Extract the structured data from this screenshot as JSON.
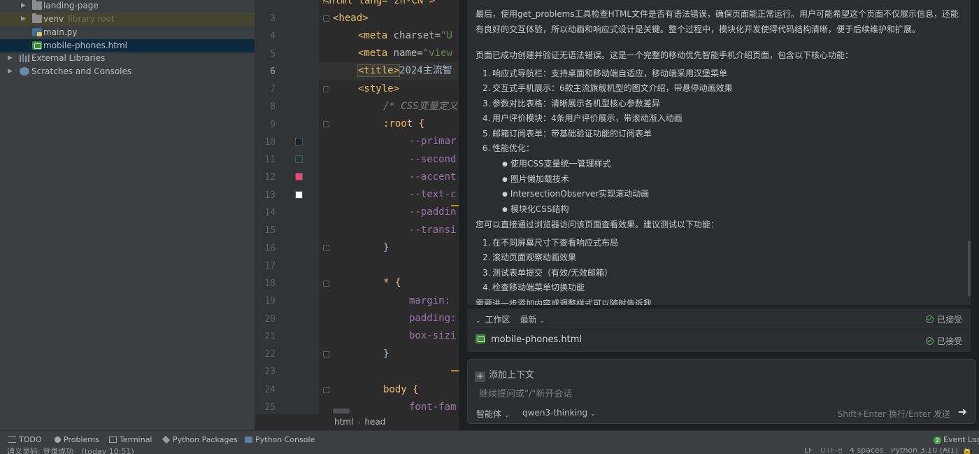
{
  "project_tree": {
    "items": [
      {
        "label": "landing-page",
        "note": ""
      },
      {
        "label": "venv",
        "note": "library root"
      },
      {
        "label": "main.py",
        "note": ""
      },
      {
        "label": "mobile-phones.html",
        "note": ""
      },
      {
        "label": "External Libraries",
        "note": ""
      },
      {
        "label": "Scratches and Consoles",
        "note": ""
      }
    ]
  },
  "editor": {
    "line_numbers": [
      "3",
      "4",
      "5",
      "6",
      "7",
      "8",
      "9",
      "10",
      "11",
      "12",
      "13",
      "14",
      "15",
      "16",
      "17",
      "18",
      "19",
      "20",
      "21",
      "22",
      "23",
      "24",
      "25"
    ],
    "current_line": "6",
    "swatch_colors": [
      "#0f2630",
      "#1c3a40",
      "#ef476f",
      "#ffffff"
    ],
    "top_fragment": "<html lang=\"zh-CN\">",
    "lines": {
      "l3": "<head>",
      "l4_tag": "<meta",
      "l4_attr": " charset=",
      "l4_str": "\"U",
      "l5_tag": "<meta",
      "l5_attr": " name=",
      "l5_str": "\"view",
      "l6_open": "<title>",
      "l6_text": "2024主流智",
      "l7": "<style>",
      "l8": "/* CSS变量定义",
      "l9": ":root {",
      "l10": "--primar",
      "l11": "--second",
      "l12": "--accent",
      "l13": "--text-c",
      "l14": "--paddin",
      "l15": "--transi",
      "l16": "}",
      "l18": "* {",
      "l19": "margin:",
      "l20": "padding:",
      "l21": "box-sizi",
      "l22": "}",
      "l24": "body {",
      "l25": "font-fam"
    },
    "breadcrumb": [
      "html",
      "head"
    ]
  },
  "chat": {
    "message": {
      "intro": "最后，使用get_problems工具检查HTML文件是否有语法错误，确保页面能正常运行。用户可能希望这个页面不仅展示信息，还能",
      "intro2": "有良好的交互体验，所以动画和响应式设计是关键。整个过程中，模块化开发使得代码结构清晰，便于后续维护和扩展。",
      "summary": "页面已成功创建并验证无语法错误。这是一个完整的移动优先智能手机介绍页面，包含以下核心功能：",
      "features": [
        {
          "num": "1.",
          "text": "响应式导航栏：支持桌面和移动端自适应，移动端采用汉堡菜单"
        },
        {
          "num": "2.",
          "text": "交互式手机展示：6款主流旗舰机型的图文介绍，带悬停动画效果"
        },
        {
          "num": "3.",
          "text": "参数对比表格：清晰展示各机型核心参数差异"
        },
        {
          "num": "4.",
          "text": "用户评价模块：4条用户评价展示，带滚动渐入动画"
        },
        {
          "num": "5.",
          "text": "邮箱订阅表单：带基础验证功能的订阅表单"
        },
        {
          "num": "6.",
          "text": "性能优化："
        }
      ],
      "optimizations": [
        "使用CSS变量统一管理样式",
        "图片懒加载技术",
        "IntersectionObserver实现滚动动画",
        "模块化CSS结构"
      ],
      "test_intro": "您可以直接通过浏览器访问该页面查看效果。建议测试以下功能：",
      "tests": [
        {
          "num": "1.",
          "text": "在不同屏幕尺寸下查看响应式布局"
        },
        {
          "num": "2.",
          "text": "滚动页面观察动画效果"
        },
        {
          "num": "3.",
          "text": "测试表单提交（有效/无效邮箱）"
        },
        {
          "num": "4.",
          "text": "检查移动端菜单切换功能"
        }
      ],
      "closing": "需要进一步添加内容或调整样式可以随时告诉我"
    },
    "workspace": {
      "title": "工作区",
      "filter": "最新",
      "status": "已接受",
      "file": "mobile-phones.html",
      "file_status": "已接受"
    },
    "input": {
      "add_context": "添加上下文",
      "placeholder": "继续提问或\"/\"新开会话",
      "mode": "智能体",
      "model": "qwen3-thinking",
      "send_hint": "Shift+Enter 换行/Enter 发送"
    }
  },
  "toolbar": {
    "todo": "TODO",
    "problems": "Problems",
    "terminal": "Terminal",
    "python_packages": "Python Packages",
    "python_console": "Python Console",
    "event_log_count": "2",
    "event_log": "Event Log"
  },
  "status_bar": {
    "message": "通义灵码: 登录成功",
    "time": "(today 10:51)",
    "line_sep": "LF",
    "encoding": "UTF-8",
    "indent": "4 spaces",
    "interpreter": "Python 3.10 (AI1)"
  }
}
